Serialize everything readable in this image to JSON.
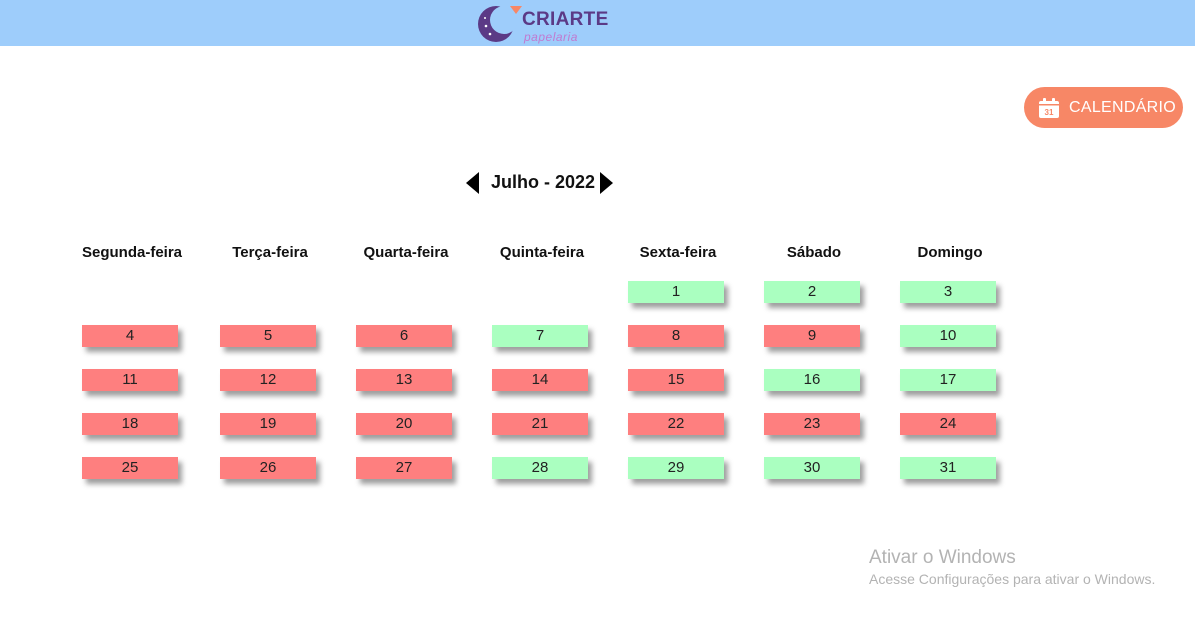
{
  "header": {
    "logo_title": "CRIARTE",
    "logo_subtitle": "papelaria",
    "bg_color": "#9ecdfb"
  },
  "calendar_button": {
    "label": "CALENDÁRIO",
    "icon": "calendar-icon",
    "icon_day": "31",
    "color": "#f78766"
  },
  "month_nav": {
    "title": "Julho - 2022",
    "prev_icon": "triangle-left-icon",
    "next_icon": "triangle-right-icon"
  },
  "weekdays": [
    "Segunda-feira",
    "Terça-feira",
    "Quarta-feira",
    "Quinta-feira",
    "Sexta-feira",
    "Sábado",
    "Domingo"
  ],
  "status_colors": {
    "busy": "#fe7f7f",
    "free": "#aaffc0"
  },
  "days": [
    {
      "day": "1",
      "status": "free"
    },
    {
      "day": "2",
      "status": "free"
    },
    {
      "day": "3",
      "status": "free"
    },
    {
      "day": "4",
      "status": "busy"
    },
    {
      "day": "5",
      "status": "busy"
    },
    {
      "day": "6",
      "status": "busy"
    },
    {
      "day": "7",
      "status": "free"
    },
    {
      "day": "8",
      "status": "busy"
    },
    {
      "day": "9",
      "status": "busy"
    },
    {
      "day": "10",
      "status": "free"
    },
    {
      "day": "11",
      "status": "busy"
    },
    {
      "day": "12",
      "status": "busy"
    },
    {
      "day": "13",
      "status": "busy"
    },
    {
      "day": "14",
      "status": "busy"
    },
    {
      "day": "15",
      "status": "busy"
    },
    {
      "day": "16",
      "status": "free"
    },
    {
      "day": "17",
      "status": "free"
    },
    {
      "day": "18",
      "status": "busy"
    },
    {
      "day": "19",
      "status": "busy"
    },
    {
      "day": "20",
      "status": "busy"
    },
    {
      "day": "21",
      "status": "busy"
    },
    {
      "day": "22",
      "status": "busy"
    },
    {
      "day": "23",
      "status": "busy"
    },
    {
      "day": "24",
      "status": "busy"
    },
    {
      "day": "25",
      "status": "busy"
    },
    {
      "day": "26",
      "status": "busy"
    },
    {
      "day": "27",
      "status": "busy"
    },
    {
      "day": "28",
      "status": "free"
    },
    {
      "day": "29",
      "status": "free"
    },
    {
      "day": "30",
      "status": "free"
    },
    {
      "day": "31",
      "status": "free"
    }
  ],
  "watermark": {
    "line1": "Ativar o Windows",
    "line2": "Acesse Configurações para ativar o Windows."
  }
}
